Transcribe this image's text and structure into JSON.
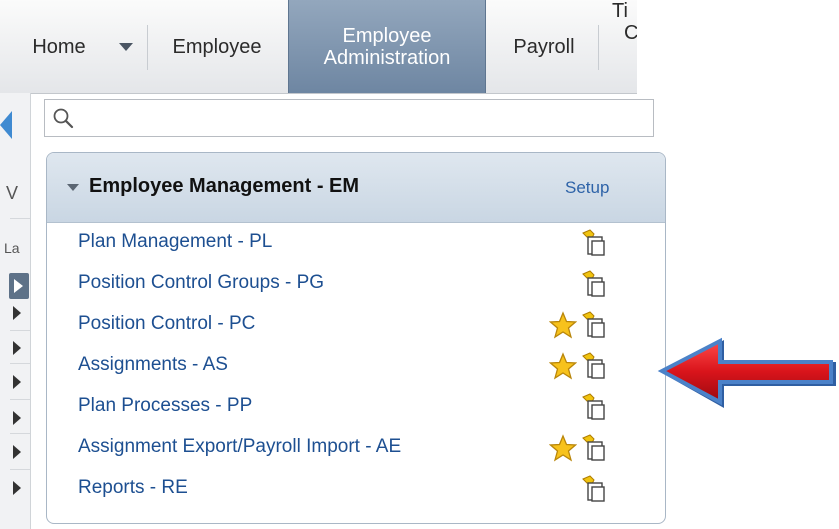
{
  "nav": {
    "home": "Home",
    "employee": "Employee",
    "employee_admin_line1": "Employee",
    "employee_admin_line2": "Administration",
    "payroll": "Payroll",
    "cutoff_line1": "Ti",
    "cutoff_line2": "C"
  },
  "left_strip": {
    "letter_v": "V",
    "letter_la": "La"
  },
  "search": {
    "placeholder": ""
  },
  "panel": {
    "title": "Employee Management - EM",
    "setup": "Setup",
    "items": [
      {
        "label": "Plan Management - PL",
        "favorite": false
      },
      {
        "label": "Position Control Groups - PG",
        "favorite": false
      },
      {
        "label": "Position Control - PC",
        "favorite": true
      },
      {
        "label": "Assignments - AS",
        "favorite": true
      },
      {
        "label": "Plan Processes - PP",
        "favorite": false
      },
      {
        "label": "Assignment Export/Payroll Import - AE",
        "favorite": true
      },
      {
        "label": "Reports - RE",
        "favorite": false
      }
    ]
  },
  "colors": {
    "active_tab": "#7a90aa",
    "link": "#1d4f91",
    "arrow_fill": "#d9141b",
    "arrow_outline": "#3a6fb8",
    "star": "#f7c21c"
  }
}
